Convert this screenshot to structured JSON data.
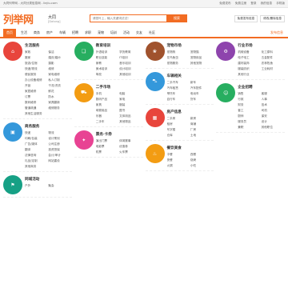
{
  "topbar": {
    "left": "大同列举网 - 大同分类信息网 - liejiu.com",
    "links": [
      "免费发布",
      "免费注册",
      "登录",
      "我的信息",
      "手机版"
    ]
  },
  "header": {
    "logo": "列举网",
    "city": "大同",
    "city_sub": "[Datong]",
    "search_placeholder": "请您叶上，输入关键词试试！",
    "search_button": "搜索",
    "post_button": "免费发布信息",
    "manage_button": "修改/删除信息"
  },
  "nav": {
    "items": [
      "首页",
      "生活",
      "商务",
      "房产",
      "车辆",
      "招聘",
      "求职",
      "宠物",
      "培训",
      "活动",
      "交友",
      "社区"
    ],
    "post": "发布信息"
  },
  "columns": [
    [
      {
        "title": "生活服务",
        "icon": "home-icon",
        "color": "c-red",
        "items": [
          "家政",
          "保洁",
          "搬家",
          "婚庆/婚纱",
          "旅游/住宿",
          "摄影",
          "快递/物流",
          "维修",
          "便民服务",
          "家电维修",
          "办公设备维修",
          "私人订制",
          "开锁",
          "干洗/洗衣",
          "家居维修",
          "鲜花",
          "订票",
          "防水",
          "数码维修",
          "家具翻新",
          "管道疏通",
          "维修服务",
          "其他生活服务"
        ]
      },
      {
        "title": "商务服务",
        "icon": "briefcase-icon",
        "color": "c-blue",
        "items": [
          "快递",
          "物流",
          "印刷/包装",
          "设计策划",
          "广告/媒体",
          "公司注册",
          "翻译",
          "投资担保",
          "法律咨询",
          "会计/审计",
          "礼品/定制",
          "网站建设",
          "其他商务"
        ]
      },
      {
        "title": "同城活动",
        "icon": "flag-icon",
        "color": "c-teal",
        "items": [
          "户外",
          "聚会"
        ]
      }
    ],
    [
      {
        "title": "教育培训",
        "icon": "book-icon",
        "color": "c-green",
        "items": [
          "外语培训",
          "学历教育",
          "职业技能",
          "IT培训",
          "家教",
          "音乐培训",
          "美术培训",
          "设计培训",
          "驾校",
          "其他培训"
        ]
      },
      {
        "title": "二手市场",
        "icon": "cart-icon",
        "color": "c-orange",
        "items": [
          "手机",
          "电脑",
          "数码产品",
          "家电",
          "家具",
          "服装",
          "母婴用品",
          "图书",
          "乐器",
          "文体用品",
          "二手车",
          "其他物品"
        ]
      },
      {
        "title": "票务·卡券",
        "icon": "ticket-icon",
        "color": "c-pink",
        "items": [
          "演出门票",
          "体育赛事",
          "电影票",
          "优惠券",
          "机票",
          "火车票"
        ]
      }
    ],
    [
      {
        "title": "宠物市场",
        "icon": "paw-icon",
        "color": "c-brown",
        "items": [
          "宠物狗",
          "宠物猫",
          "花鸟鱼虫",
          "宠物用品",
          "宠物服务",
          "其他宠物"
        ]
      },
      {
        "title": "车辆相关",
        "icon": "car-icon",
        "color": "c-blue",
        "items": [
          "二手汽车",
          "新车",
          "汽车租赁",
          "汽车配件",
          "摩托车",
          "电动车",
          "自行车",
          "货车"
        ]
      },
      {
        "title": "房产信息",
        "icon": "building-icon",
        "color": "c-red",
        "items": [
          "二手房",
          "新房",
          "租房",
          "商铺",
          "写字楼",
          "厂房",
          "仓库",
          "土地"
        ]
      },
      {
        "title": "餐饮美食",
        "icon": "food-icon",
        "color": "c-orange",
        "items": [
          "中餐",
          "西餐",
          "快餐",
          "烧烤",
          "火锅",
          "小吃"
        ]
      }
    ],
    [
      {
        "title": "行业市场",
        "icon": "factory-icon",
        "color": "c-purple",
        "items": [
          "机械设备",
          "化工原料",
          "电子电工",
          "五金配件",
          "建材装饰",
          "农林牧渔",
          "服装纺织",
          "工业耗材",
          "其他行业"
        ]
      },
      {
        "title": "企业招聘",
        "icon": "user-icon",
        "color": "c-green",
        "items": [
          "销售",
          "客服",
          "行政",
          "人事",
          "财务",
          "技术",
          "普工",
          "司机",
          "厨师",
          "保安",
          "服务员",
          "设计",
          "兼职",
          "其他职位"
        ]
      }
    ]
  ]
}
